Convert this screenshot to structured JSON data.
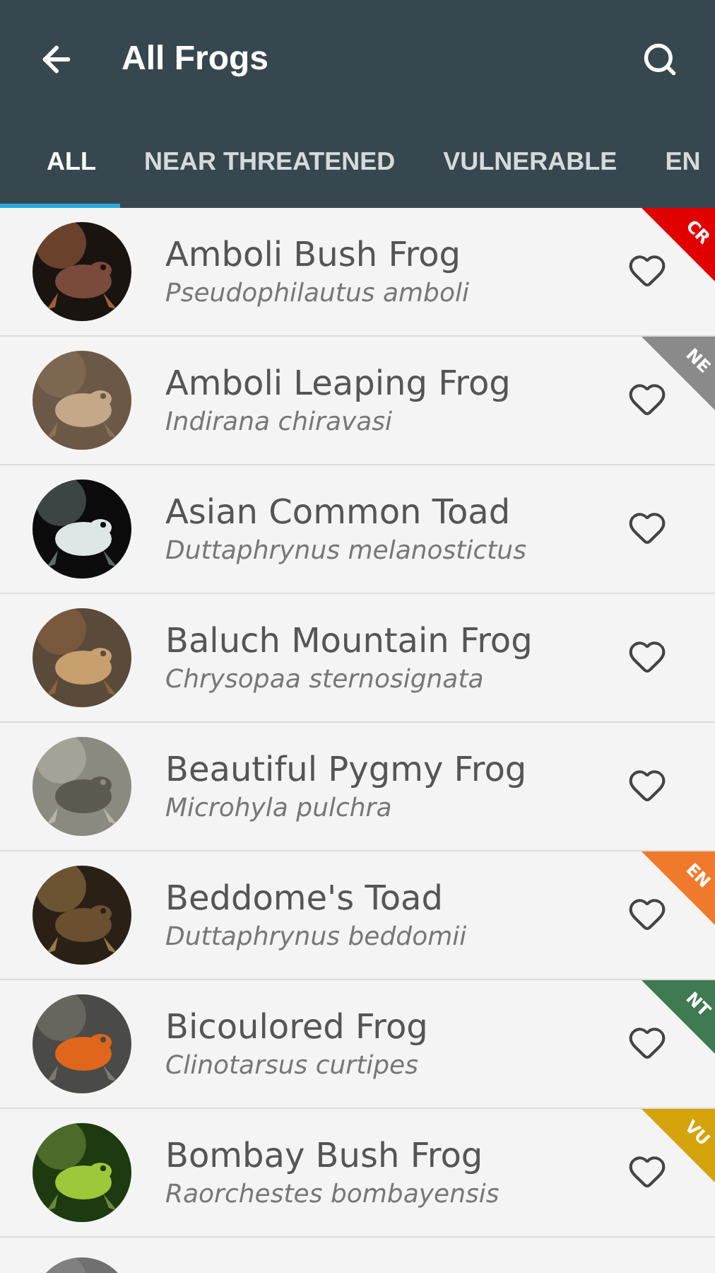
{
  "app_bar": {
    "title": "All Frogs"
  },
  "tabs": [
    {
      "label": "ALL",
      "selected": true
    },
    {
      "label": "NEAR THREATENED",
      "selected": false
    },
    {
      "label": "VULNERABLE",
      "selected": false
    },
    {
      "label": "EN",
      "selected": false
    }
  ],
  "frogs": [
    {
      "name": "Amboli Bush Frog",
      "scientific_name": "Pseudophilautus amboli",
      "status": {
        "label": "CR",
        "color": "#e00000"
      }
    },
    {
      "name": "Amboli Leaping Frog",
      "scientific_name": "Indirana chiravasi",
      "status": {
        "label": "NE",
        "color": "#8a8a8a"
      }
    },
    {
      "name": "Asian Common Toad",
      "scientific_name": "Duttaphrynus melanostictus"
    },
    {
      "name": "Baluch Mountain Frog",
      "scientific_name": "Chrysopaa sternosignata"
    },
    {
      "name": "Beautiful Pygmy Frog",
      "scientific_name": "Microhyla pulchra"
    },
    {
      "name": "Beddome's Toad",
      "scientific_name": "Duttaphrynus beddomii",
      "status": {
        "label": "EN",
        "color": "#f07a2c"
      }
    },
    {
      "name": "Bicoulored Frog",
      "scientific_name": "Clinotarsus curtipes",
      "status": {
        "label": "NT",
        "color": "#3f7a52"
      }
    },
    {
      "name": "Bombay Bush Frog",
      "scientific_name": "Raorchestes bombayensis",
      "status": {
        "label": "VU",
        "color": "#d4a20a"
      }
    },
    {
      "kind": "partial"
    }
  ]
}
